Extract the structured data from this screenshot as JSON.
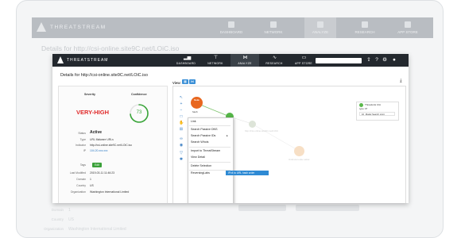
{
  "background_app": {
    "brand": "THREATSTREAM",
    "nav": [
      "DASHBOARD",
      "NETWORK",
      "ANALYZE",
      "RESEARCH",
      "APP STORE"
    ],
    "title": "Details for http://csi-online.site9C.net/LOiC.iso",
    "footer_rows": [
      {
        "key": "Domain",
        "value": "1"
      },
      {
        "key": "Country",
        "value": "US"
      },
      {
        "key": "Organization",
        "value": "Washington International Limited"
      }
    ]
  },
  "window": {
    "brand": "THREATSTREAM",
    "nav": [
      {
        "label": "DASHBOARD",
        "icon": "dashboard-icon"
      },
      {
        "label": "NETWORK",
        "icon": "network-icon"
      },
      {
        "label": "ANALYZE",
        "icon": "analyze-icon"
      },
      {
        "label": "RESEARCH",
        "icon": "research-icon"
      },
      {
        "label": "APP STORE",
        "icon": "app-store-icon"
      }
    ],
    "active_nav": "ANALYZE",
    "search_placeholder": "",
    "title": "Details for http://csi-online.site9C.net/LOiC.iso",
    "view_label": "View:"
  },
  "scores": {
    "severity_header": "Severity",
    "confidence_header": "Confidence",
    "severity": "VERY-HIGH",
    "confidence": "73",
    "confidence_fraction": 0.73,
    "colors": {
      "severity": "#e02a2a",
      "confidence": "#3aa63a"
    }
  },
  "details": {
    "status_key": "Status",
    "status_value": "Active",
    "rows": [
      {
        "key": "Type",
        "value": "URL Malware URLs"
      },
      {
        "key": "Indicator",
        "value": "http://csi-online.site9C.net/LOiC.iso"
      },
      {
        "key": "IP",
        "value": "104.20.xxx.xxx"
      }
    ],
    "tags_key": "Tags",
    "edit_label": "Edit",
    "rows2": [
      {
        "key": "Last Modified",
        "value": "2019-03-11 11:46:23"
      },
      {
        "key": "Domain",
        "value": "1"
      },
      {
        "key": "Country",
        "value": "US"
      },
      {
        "key": "Organization",
        "value": "Washington International Limited"
      }
    ]
  },
  "graph": {
    "main_node_label": "Node",
    "main_node_sub": "hash",
    "faded_labels": [
      "http://csi-online.site9C.net/LOiC",
      "Unknown-site Label"
    ],
    "tools": [
      "select-icon",
      "zoom-in-icon",
      "zoom-out-icon",
      "fit-icon",
      "hand-icon",
      "layout-icon",
      "link-icon",
      "eye-icon",
      "filter-icon",
      "settings-icon"
    ]
  },
  "context_menu": {
    "items": [
      "Link",
      "Search Passive DNS",
      "Search Passive IDs",
      "Search Whois",
      "Import to ThreatStream",
      "View Detail",
      "Delete Selection",
      "ReversingLabs"
    ],
    "tooltip": "IPv4 to URL hash order"
  },
  "legend": {
    "title": "ThreatLink CIA",
    "type_label": "type:",
    "type_value": "IP",
    "dropdown": "Model Search Limit",
    "dropdown_num": "10"
  }
}
